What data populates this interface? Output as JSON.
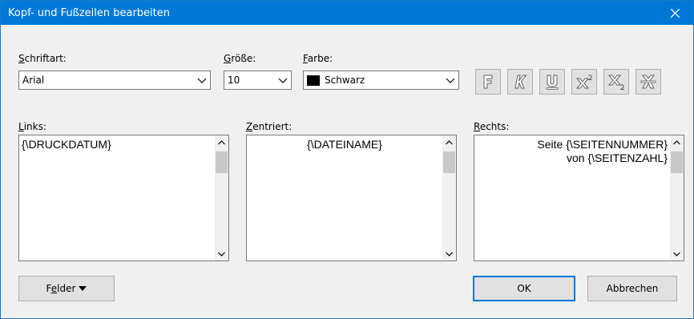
{
  "window": {
    "title": "Kopf- und Fußzeilen bearbeiten"
  },
  "font": {
    "label": "Schriftart:",
    "value": "Arial"
  },
  "size": {
    "label": "Größe:",
    "value": "10"
  },
  "color": {
    "label": "Farbe:",
    "value": "Schwarz",
    "swatch": "#000000"
  },
  "format_buttons": [
    "bold-icon",
    "italic-icon",
    "underline-icon",
    "superscript-icon",
    "subscript-icon",
    "strikethrough-icon"
  ],
  "sections": {
    "left": {
      "label": "Links:",
      "lines": [
        "{\\DRUCKDATUM}"
      ]
    },
    "center": {
      "label": "Zentriert:",
      "lines": [
        "{\\DATEINAME}"
      ]
    },
    "right": {
      "label": "Rechts:",
      "lines": [
        "Seite {\\SEITENNUMMER}",
        "von {\\SEITENZAHL}"
      ]
    }
  },
  "buttons": {
    "fields": "Felder",
    "ok": "OK",
    "cancel": "Abbrechen"
  },
  "colors": {
    "titlebar": "#0078d7",
    "dialog_bg": "#f0f0f0",
    "default_button_border": "#0078d7"
  }
}
